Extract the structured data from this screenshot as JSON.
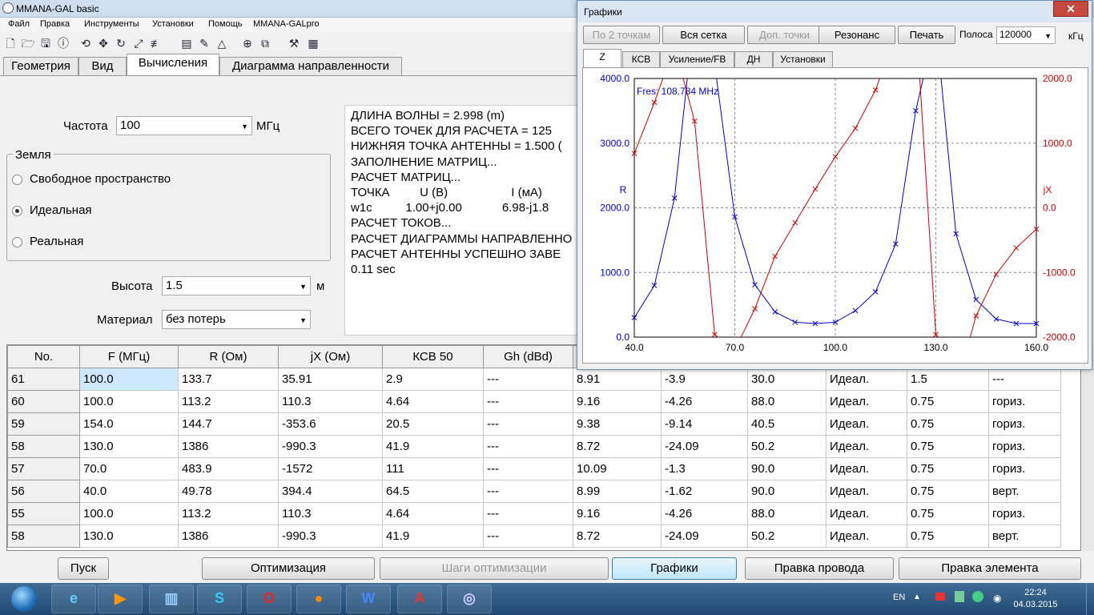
{
  "window": {
    "title": "MMANA-GAL basic"
  },
  "menu": [
    "Файл",
    "Правка",
    "Инструменты",
    "Установки",
    "Помощь",
    "MMANA-GALpro"
  ],
  "tabs": [
    "Геометрия",
    "Вид",
    "Вычисления",
    "Диаграмма направленности"
  ],
  "active_tab": "Вычисления",
  "form": {
    "freq_label": "Частота",
    "freq_value": "100",
    "freq_unit": "МГц",
    "ground_label": "Земля",
    "ground_options": [
      "Свободное пространство",
      "Идеальная",
      "Реальная"
    ],
    "ground_selected": "Идеальная",
    "height_label": "Высота",
    "height_value": "1.5",
    "height_unit": "м",
    "material_label": "Материал",
    "material_value": "без потерь"
  },
  "log": [
    "ДЛИНА ВОЛНЫ = 2.998 (m)",
    "ВСЕГО ТОЧЕК ДЛЯ РАСЧЕТА = 125",
    "НИЖНЯЯ ТОЧКА АНТЕННЫ = 1.500 (",
    "ЗАПОЛНЕНИЕ МАТРИЦ...",
    "РАСЧЕТ МАТРИЦ...",
    "ТОЧКА         U (B)                   I (мА)",
    "w1c          1.00+j0.00            6.98-j1.8",
    "РАСЧЕТ ТОКОВ...",
    "РАСЧЕТ ДИАГРАММЫ НАПРАВЛЕННО",
    "РАСЧЕТ АНТЕННЫ УСПЕШНО ЗАВЕ",
    "0.11 sec"
  ],
  "table": {
    "headers": [
      "No.",
      "F (МГц)",
      "R (Ом)",
      "jX (Ом)",
      "КСВ 50",
      "Gh (dBd)",
      "",
      "",
      "",
      "",
      "",
      ""
    ],
    "rows": [
      [
        "61",
        "100.0",
        "133.7",
        "35.91",
        "2.9",
        "---",
        "8.91",
        "-3.9",
        "30.0",
        "Идеал.",
        "1.5",
        "---"
      ],
      [
        "60",
        "100.0",
        "113.2",
        "110.3",
        "4.64",
        "---",
        "9.16",
        "-4.26",
        "88.0",
        "Идеал.",
        "0.75",
        "гориз."
      ],
      [
        "59",
        "154.0",
        "144.7",
        "-353.6",
        "20.5",
        "---",
        "9.38",
        "-9.14",
        "40.5",
        "Идеал.",
        "0.75",
        "гориз."
      ],
      [
        "58",
        "130.0",
        "1386",
        "-990.3",
        "41.9",
        "---",
        "8.72",
        "-24.09",
        "50.2",
        "Идеал.",
        "0.75",
        "гориз."
      ],
      [
        "57",
        "70.0",
        "483.9",
        "-1572",
        "111",
        "---",
        "10.09",
        "-1.3",
        "90.0",
        "Идеал.",
        "0.75",
        "гориз."
      ],
      [
        "56",
        "40.0",
        "49.78",
        "394.4",
        "64.5",
        "---",
        "8.99",
        "-1.62",
        "90.0",
        "Идеал.",
        "0.75",
        "верт."
      ],
      [
        "55",
        "100.0",
        "113.2",
        "110.3",
        "4.64",
        "---",
        "9.16",
        "-4.26",
        "88.0",
        "Идеал.",
        "0.75",
        "гориз."
      ],
      [
        "58",
        "130.0",
        "1386",
        "-990.3",
        "41.9",
        "---",
        "8.72",
        "-24.09",
        "50.2",
        "Идеал.",
        "0.75",
        "верт."
      ]
    ]
  },
  "buttons": {
    "start": "Пуск",
    "optimize": "Оптимизация",
    "opt_steps": "Шаги оптимизации",
    "graphs": "Графики",
    "edit_wire": "Правка провода",
    "edit_element": "Правка элемента"
  },
  "taskbar": {
    "lang": "EN",
    "time": "22:24",
    "date": "04.03.2015"
  },
  "graph_window": {
    "title": "Графики",
    "buttons": [
      "По 2 точкам",
      "Вся сетка",
      "Доп. точки",
      "Резонанс",
      "Печать"
    ],
    "band_label": "Полоса",
    "band_value": "120000",
    "band_unit": "кГц",
    "tabs": [
      "Z",
      "КСВ",
      "Усиление/FB",
      "ДН",
      "Установки"
    ],
    "active_tab": "Z"
  },
  "chart_data": {
    "type": "line",
    "annotation": "Fres: 108.784 MHz",
    "xlim": [
      40.0,
      160.0
    ],
    "x_ticks": [
      "40.0",
      "70.0",
      "100.0",
      "130.0",
      "160.0"
    ],
    "left_axis": {
      "label": "R",
      "lim": [
        0,
        4000
      ],
      "ticks": [
        "0.0",
        "1000.0",
        "2000.0",
        "3000.0",
        "4000.0"
      ],
      "color": "#0000cc"
    },
    "right_axis": {
      "label": "jX",
      "lim": [
        -2000,
        2000
      ],
      "ticks": [
        "-2000.0",
        "-1000.0",
        "0.0",
        "1000.0",
        "2000.0"
      ],
      "color": "#cc0000"
    },
    "grid": true,
    "series": [
      {
        "axis": "left",
        "color": "#0000cc",
        "x": [
          40,
          46,
          52,
          58,
          64,
          70,
          76,
          82,
          88,
          94,
          100,
          106,
          112,
          118,
          124,
          130,
          136,
          142,
          148,
          154,
          160
        ],
        "y": [
          300,
          800,
          2150,
          5060,
          4220,
          1860,
          810,
          390,
          230,
          210,
          230,
          410,
          700,
          1440,
          3500,
          4850,
          1600,
          580,
          280,
          210,
          210
        ]
      },
      {
        "axis": "right",
        "color": "#cc0000",
        "x": [
          40,
          46,
          52,
          58,
          64,
          70,
          76,
          82,
          88,
          94,
          100,
          106,
          112,
          118,
          124,
          130,
          136,
          142,
          148,
          154,
          160
        ],
        "y": [
          840,
          1630,
          2500,
          1340,
          -1960,
          -2200,
          -1560,
          -750,
          -230,
          290,
          790,
          1230,
          1820,
          2700,
          3000,
          -1960,
          -2800,
          -1670,
          -1030,
          -620,
          -330
        ]
      }
    ]
  }
}
